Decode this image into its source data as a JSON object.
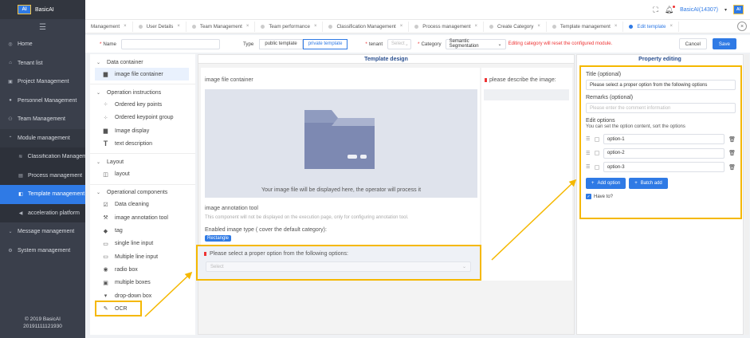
{
  "app": {
    "logo_mark": "AI",
    "name": "BasicAI"
  },
  "sidebar": {
    "items": [
      {
        "label": "Home",
        "icon": "home-icon"
      },
      {
        "label": "Tenant list",
        "icon": "house-icon"
      },
      {
        "label": "Project Management",
        "icon": "briefcase-icon"
      },
      {
        "label": "Personnel Management",
        "icon": "user-icon"
      },
      {
        "label": "Team Management",
        "icon": "team-icon"
      },
      {
        "label": "Module management",
        "icon": "chevron-up-icon"
      },
      {
        "label": "Classification Management",
        "icon": "layers-icon"
      },
      {
        "label": "Process management",
        "icon": "doc-icon"
      },
      {
        "label": "Template management",
        "icon": "template-icon"
      },
      {
        "label": "acceleration platform",
        "icon": "flag-icon"
      },
      {
        "label": "Message management",
        "icon": "chevron-down-icon"
      },
      {
        "label": "System management",
        "icon": "gear-icon"
      }
    ],
    "copyright": "© 2019 BasicAI",
    "version": "20191111121930"
  },
  "topbar": {
    "user": "BasicAI(14307)",
    "avatar": "AI"
  },
  "tabs": [
    {
      "label": "Management"
    },
    {
      "label": "User Details"
    },
    {
      "label": "Team Management"
    },
    {
      "label": "Team performance"
    },
    {
      "label": "Classification Management"
    },
    {
      "label": "Process management"
    },
    {
      "label": "Create Category"
    },
    {
      "label": "Template management"
    },
    {
      "label": "Edit template"
    }
  ],
  "form": {
    "name_label": "Name",
    "type_label": "Type",
    "type_public": "public template",
    "type_private": "private template",
    "tenant_label": "tenant",
    "tenant_placeholder": "Select",
    "category_label": "Category",
    "category_value": "Semantic Segmentation",
    "warning": "Editing category will reset the configured module.",
    "cancel": "Cancel",
    "save": "Save"
  },
  "components": {
    "groups": [
      {
        "title": "Data container",
        "items": [
          {
            "label": "image file container",
            "icon": "image-icon"
          }
        ]
      },
      {
        "title": "Operation instructions",
        "items": [
          {
            "label": "Ordered key points",
            "icon": "keypoint-icon"
          },
          {
            "label": "Ordered keypoint group",
            "icon": "keypoint-group-icon"
          },
          {
            "label": "Image display",
            "icon": "image-icon"
          },
          {
            "label": "text description",
            "icon": "text-icon"
          }
        ]
      },
      {
        "title": "Layout",
        "items": [
          {
            "label": "layout",
            "icon": "layout-icon"
          }
        ]
      },
      {
        "title": "Operational components",
        "items": [
          {
            "label": "Data cleaning",
            "icon": "checkbox-icon"
          },
          {
            "label": "image annotation tool",
            "icon": "hammer-icon"
          },
          {
            "label": "tag",
            "icon": "tag-icon"
          },
          {
            "label": "single line input",
            "icon": "input-icon"
          },
          {
            "label": "Multiple line input",
            "icon": "textarea-icon"
          },
          {
            "label": "radio box",
            "icon": "radio-icon"
          },
          {
            "label": "multiple boxes",
            "icon": "checkboxes-icon"
          },
          {
            "label": "drop-down box",
            "icon": "dropdown-icon"
          },
          {
            "label": "OCR",
            "icon": "pen-icon"
          }
        ]
      }
    ]
  },
  "design": {
    "title": "Template design",
    "container_label": "image file container",
    "image_hint": "Your image file will be displayed here, the operator will process it",
    "describe_label": "please describe the image:",
    "tool_label": "image annotation tool",
    "tool_note": "This component will not be displayed on the execution page, only for configuring annotation tool.",
    "enabled_label": "Enabled image type ( cover the default category):",
    "chip": "Rectangle",
    "option_label": "Please select a proper option from the following options:",
    "select_placeholder": "Select"
  },
  "property": {
    "title": "Property editing",
    "title_label": "Title (optional)",
    "title_value": "Please select a proper option from the following options",
    "remarks_label": "Remarks (optional)",
    "remarks_placeholder": "Please enter the comment information",
    "edit_label": "Edit options",
    "edit_hint": "You can set the option content, sort the options",
    "options": [
      "option-1",
      "option-2",
      "option-3"
    ],
    "add_option": "Add option",
    "batch_add": "Batch add",
    "have_to": "Have to?"
  },
  "colors": {
    "accent": "#2f7ae5",
    "highlight": "#f5b800",
    "sidebar": "#3a3f4b",
    "danger": "#e33333"
  }
}
